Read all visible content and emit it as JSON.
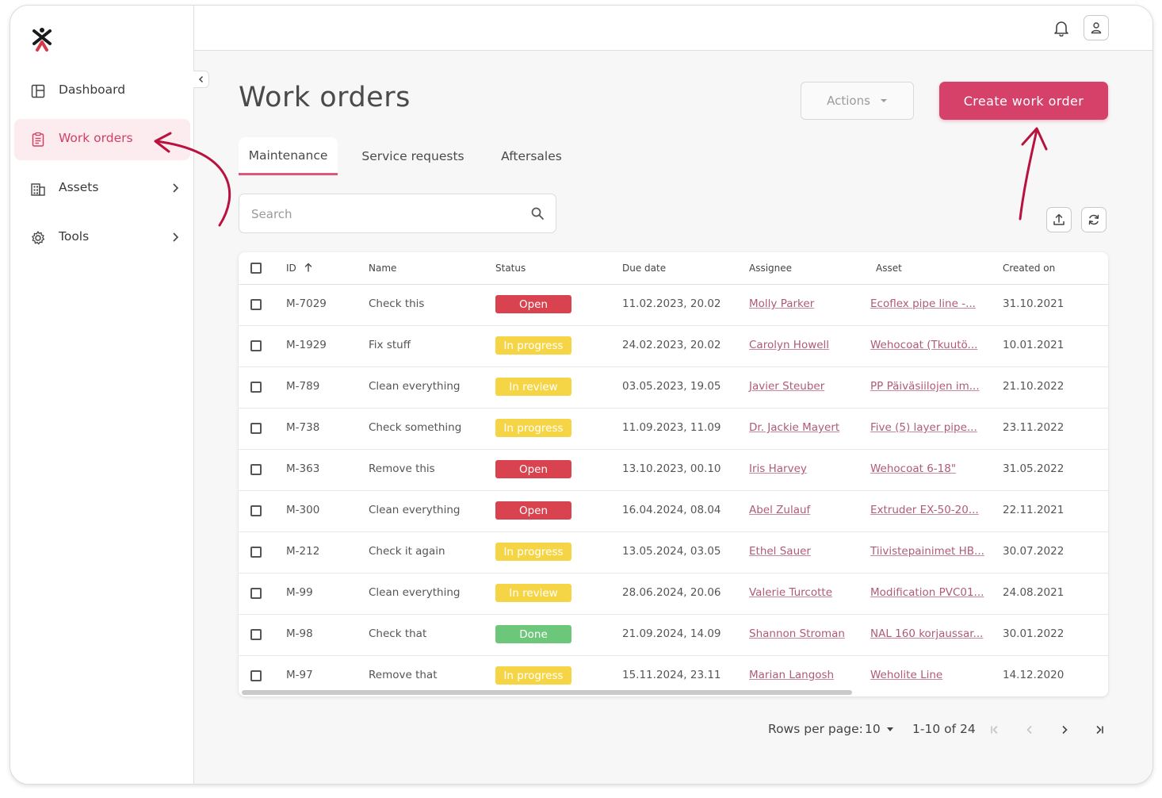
{
  "sidebar": {
    "items": [
      {
        "label": "Dashboard",
        "icon": "dashboard-icon",
        "has_submenu": false
      },
      {
        "label": "Work orders",
        "icon": "clipboard-icon",
        "has_submenu": false,
        "active": true
      },
      {
        "label": "Assets",
        "icon": "building-icon",
        "has_submenu": true
      },
      {
        "label": "Tools",
        "icon": "gear-icon",
        "has_submenu": true
      }
    ]
  },
  "header": {
    "title": "Work orders",
    "actions_label": "Actions",
    "create_label": "Create work order"
  },
  "tabs": [
    {
      "label": "Maintenance",
      "active": true
    },
    {
      "label": "Service requests",
      "active": false
    },
    {
      "label": "Aftersales",
      "active": false
    }
  ],
  "search": {
    "placeholder": "Search"
  },
  "table": {
    "columns": [
      "ID",
      "Name",
      "Status",
      "Due date",
      "Assignee",
      "Asset",
      "Created on"
    ],
    "rows": [
      {
        "id": "M-7029",
        "name": "Check this",
        "status": "Open",
        "due": "11.02.2023, 20.02",
        "assignee": "Molly Parker",
        "asset": "Ecoflex pipe line -...",
        "created": "31.10.2021"
      },
      {
        "id": "M-1929",
        "name": "Fix stuff",
        "status": "In progress",
        "due": "24.02.2023, 20.02",
        "assignee": "Carolyn Howell",
        "asset": "Wehocoat (Tkuutö...",
        "created": "10.01.2021"
      },
      {
        "id": "M-789",
        "name": "Clean everything",
        "status": "In review",
        "due": "03.05.2023, 19.05",
        "assignee": "Javier Steuber",
        "asset": "PP Päiväsiilojen im...",
        "created": "21.10.2022"
      },
      {
        "id": "M-738",
        "name": "Check something",
        "status": "In progress",
        "due": "11.09.2023, 11.09",
        "assignee": "Dr. Jackie Mayert",
        "asset": "Five (5) layer pipe...",
        "created": "23.11.2022"
      },
      {
        "id": "M-363",
        "name": "Remove this",
        "status": "Open",
        "due": "13.10.2023, 00.10",
        "assignee": "Iris Harvey",
        "asset": "Wehocoat 6-18\"",
        "created": "31.05.2022"
      },
      {
        "id": "M-300",
        "name": "Clean everything",
        "status": "Open",
        "due": "16.04.2024, 08.04",
        "assignee": "Abel Zulauf",
        "asset": "Extruder EX-50-20...",
        "created": "22.11.2021"
      },
      {
        "id": "M-212",
        "name": "Check it again",
        "status": "In progress",
        "due": "13.05.2024, 03.05",
        "assignee": "Ethel Sauer",
        "asset": "Tiivistepainimet HB...",
        "created": "30.07.2022"
      },
      {
        "id": "M-99",
        "name": "Clean everything",
        "status": "In review",
        "due": "28.06.2024, 20.06",
        "assignee": "Valerie Turcotte",
        "asset": "Modification PVC01...",
        "created": "24.08.2021"
      },
      {
        "id": "M-98",
        "name": "Check that",
        "status": "Done",
        "due": "21.09.2024, 14.09",
        "assignee": "Shannon Stroman",
        "asset": "NAL 160 korjaussar...",
        "created": "30.01.2022"
      },
      {
        "id": "M-97",
        "name": "Remove that",
        "status": "In progress",
        "due": "15.11.2024, 23.11",
        "assignee": "Marian Langosh",
        "asset": "Weholite Line",
        "created": "14.12.2020"
      }
    ]
  },
  "status_colors": {
    "Open": "#d9434f",
    "In progress": "#f5d545",
    "In review": "#f5d545",
    "Done": "#6cc77a"
  },
  "pagination": {
    "rows_per_page_label": "Rows per page:",
    "rows_per_page_value": "10",
    "range": "1-10 of 24"
  },
  "colors": {
    "accent": "#d6416a",
    "annotation": "#b8123e"
  }
}
